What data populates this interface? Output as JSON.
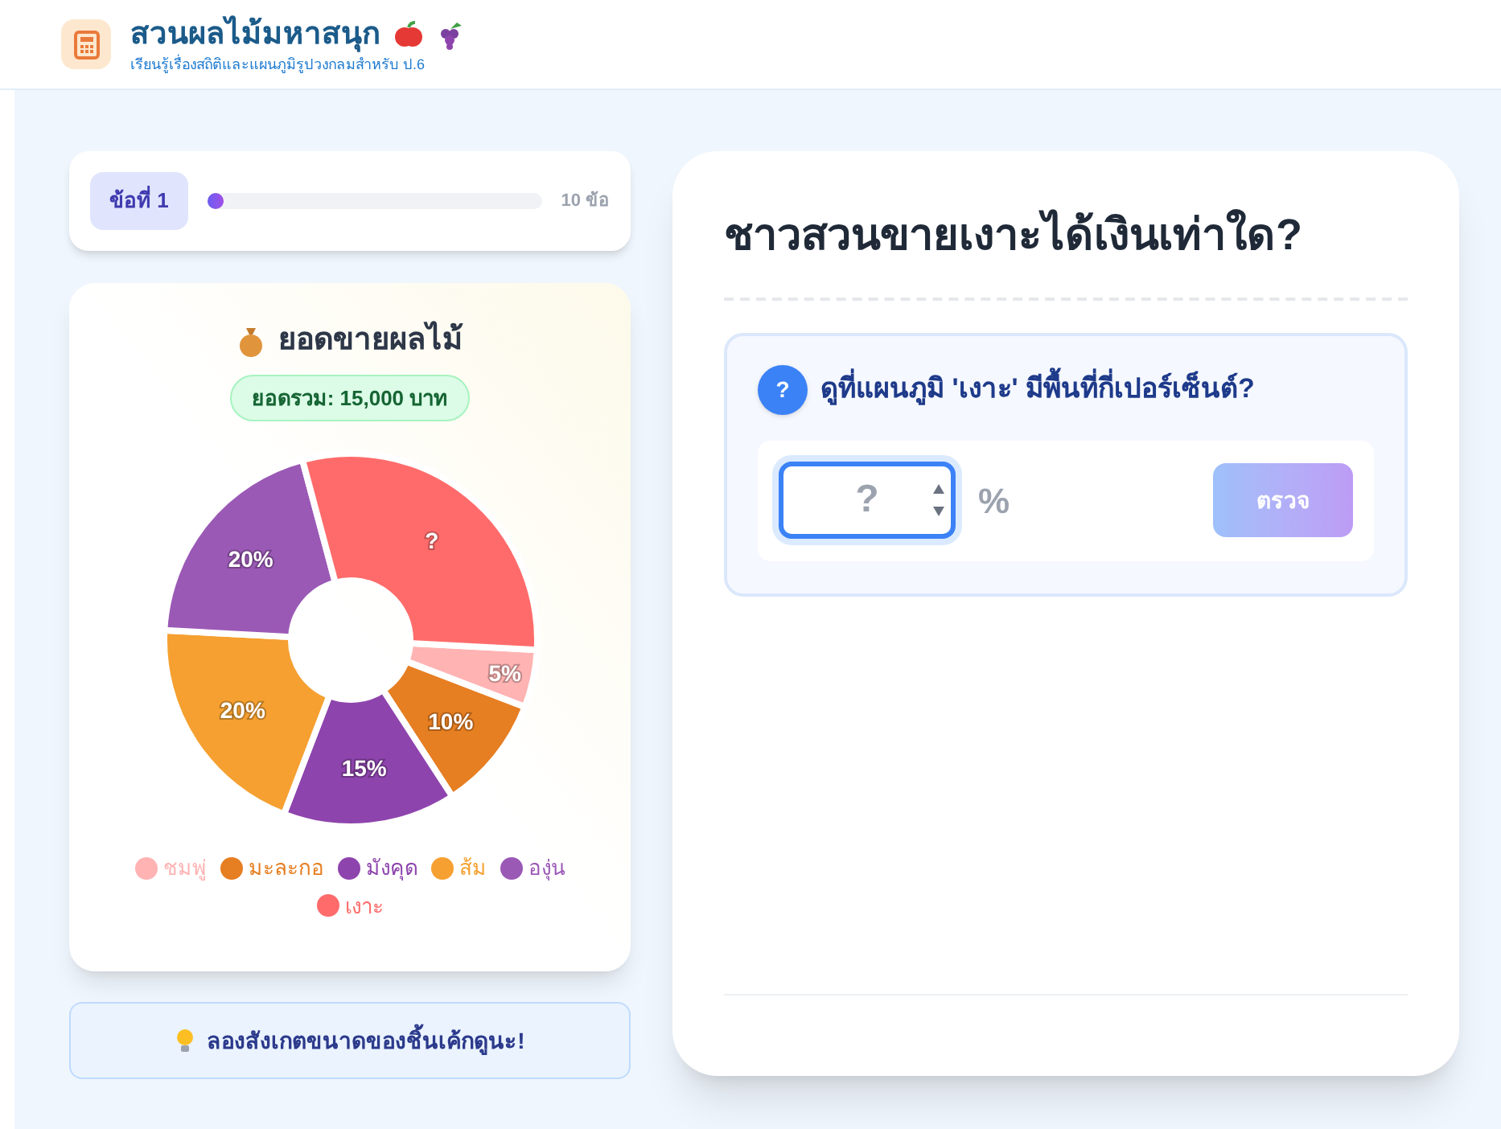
{
  "header": {
    "title": "สวนผลไม้มหาสนุก",
    "subtitle": "เรียนรู้เรื่องสถิติและแผนภูมิรูปวงกลมสำหรับ ป.6"
  },
  "progress": {
    "label": "ข้อที่ 1",
    "level": 0.05,
    "total": "10 ข้อ"
  },
  "chart_card": {
    "title": "ยอดขายผลไม้",
    "total": "ยอดรวม: 15,000 บาท",
    "chart_data": {
      "type": "donut",
      "categories": [
        "ชมพู่",
        "มะละกอ",
        "มังคุด",
        "ส้ม",
        "องุ่น",
        "เงาะ"
      ],
      "values": [
        5,
        10,
        15,
        20,
        20,
        30
      ],
      "value_labels": [
        "5%",
        "10%",
        "15%",
        "20%",
        "20%",
        "?"
      ],
      "colors": [
        "#ffb3b3",
        "#e67e22",
        "#8e44ad",
        "#f5a031",
        "#9b59b6",
        "#ff6b6b"
      ]
    }
  },
  "hint": "ลองสังเกตขนาดของชิ้นเค้กดูนะ!",
  "question": {
    "title": "ชาวสวนขายเงาะได้เงินเท่าใด?",
    "prompt": "ดูที่แผนภูมิ 'เงาะ' มีพื้นที่กี่เปอร์เซ็นต์?",
    "badge": "?",
    "placeholder": "?",
    "unit": "%",
    "button": "ตรวจ",
    "button_disabled": true
  }
}
